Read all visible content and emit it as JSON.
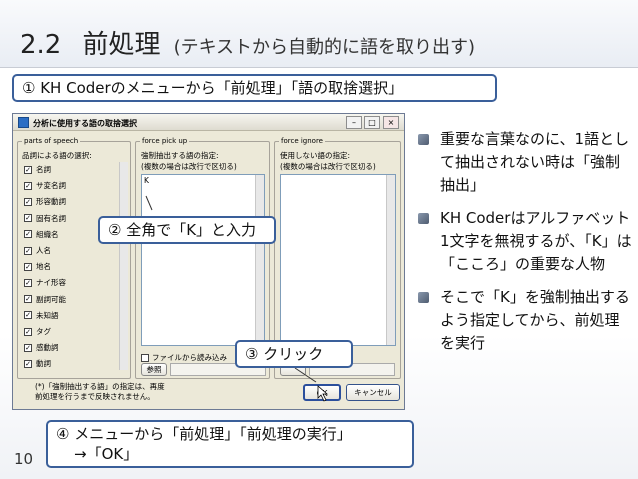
{
  "title": {
    "number": "2.2",
    "main": "前処理",
    "sub": "(テキストから自動的に語を取り出す)"
  },
  "callouts": {
    "step1": "① KH Coderのメニューから「前処理」「語の取捨選択」",
    "step2": "② 全角で「K」と入力",
    "step3": "③ クリック",
    "step4_line1": "④ メニューから「前処理」「前処理の実行」",
    "step4_line2": "→「OK」"
  },
  "dialog": {
    "title": "分析に使用する語の取捨選択",
    "pos_group": "parts of speech",
    "pos_heading": "品詞による語の選択:",
    "pos_items": [
      "名詞",
      "サ変名詞",
      "形容動詞",
      "固有名詞",
      "組織名",
      "人名",
      "地名",
      "ナイ形容",
      "副詞可能",
      "未知語",
      "タグ",
      "感動詞",
      "動詞"
    ],
    "pickup_group": "force pick up",
    "pickup_heading1": "強制抽出する語の指定:",
    "pickup_heading2": "(複数の場合は改行で区切る)",
    "pickup_value": "K",
    "pickup_file_check": "ファイルから読み込み",
    "pickup_browse": "参照",
    "ignore_group": "force ignore",
    "ignore_heading1": "使用しない語の指定:",
    "ignore_heading2": "(複数の場合は改行で区切る)",
    "note_line1": "(*)「強制抽出する語」の指定は、再度",
    "note_line2": "前処理を行うまで反映されません。",
    "ok": "OK",
    "cancel": "キャンセル"
  },
  "bullets": [
    "重要な言葉なのに、1語として抽出されない時は「強制抽出」",
    "KH Coderはアルファベット1文字を無視するが、「K」は「こころ」の重要な人物",
    "そこで「K」を強制抽出するよう指定してから、前処理を実行"
  ],
  "page_number": "10"
}
